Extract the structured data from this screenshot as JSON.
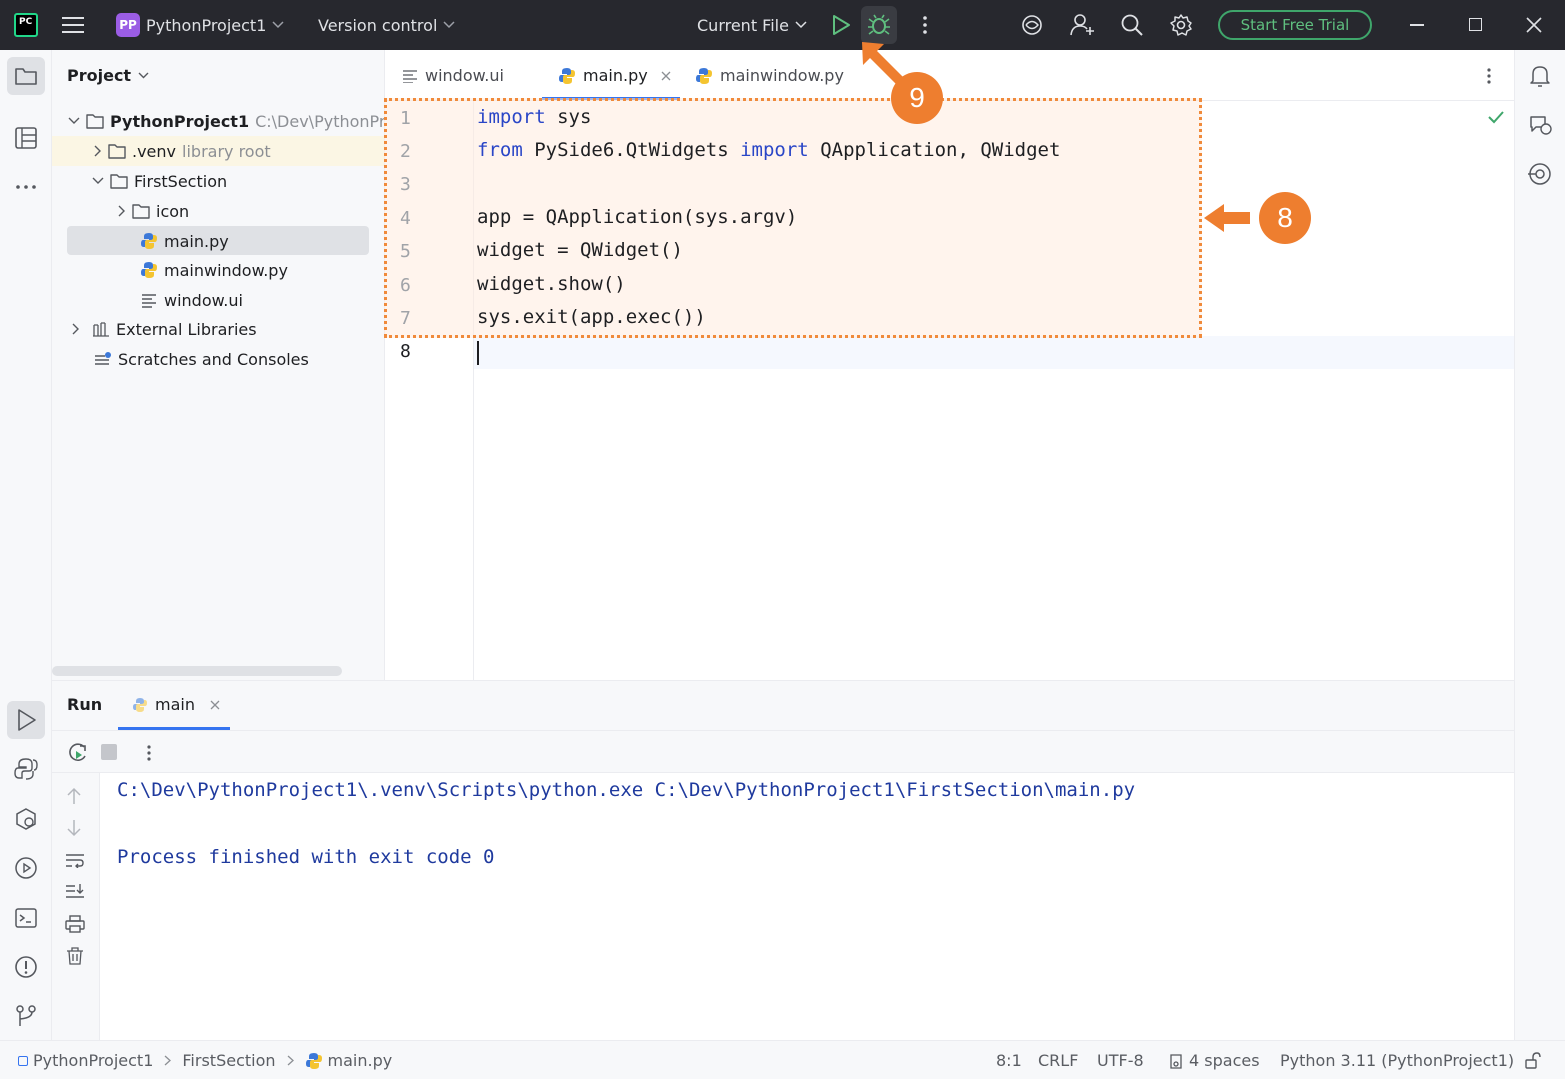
{
  "titlebar": {
    "project_badge": "PP",
    "project_name": "PythonProject1",
    "version_control": "Version control",
    "run_config": "Current File",
    "trial_button": "Start Free Trial"
  },
  "project_panel": {
    "title": "Project",
    "tree": [
      {
        "label": "PythonProject1",
        "hint": "C:\\Dev\\PythonProj"
      },
      {
        "label": ".venv",
        "hint": "library root"
      },
      {
        "label": "FirstSection"
      },
      {
        "label": "icon"
      },
      {
        "label": "main.py"
      },
      {
        "label": "mainwindow.py"
      },
      {
        "label": "window.ui"
      },
      {
        "label": "External Libraries"
      },
      {
        "label": "Scratches and Consoles"
      }
    ]
  },
  "editor": {
    "tabs": [
      {
        "label": "window.ui"
      },
      {
        "label": "main.py",
        "active": true
      },
      {
        "label": "mainwindow.py"
      }
    ],
    "lines": [
      {
        "n": "1",
        "kw1": "import",
        "rest1": " sys",
        "kw2": "",
        "rest2": ""
      },
      {
        "n": "2",
        "kw1": "from",
        "rest1": " PySide6.QtWidgets ",
        "kw2": "import",
        "rest2": " QApplication, QWidget"
      },
      {
        "n": "3",
        "kw1": "",
        "rest1": "",
        "kw2": "",
        "rest2": ""
      },
      {
        "n": "4",
        "kw1": "",
        "rest1": "app = QApplication(sys.argv)",
        "kw2": "",
        "rest2": ""
      },
      {
        "n": "5",
        "kw1": "",
        "rest1": "widget = QWidget()",
        "kw2": "",
        "rest2": ""
      },
      {
        "n": "6",
        "kw1": "",
        "rest1": "widget.show()",
        "kw2": "",
        "rest2": ""
      },
      {
        "n": "7",
        "kw1": "",
        "rest1": "sys.exit(app.exec())",
        "kw2": "",
        "rest2": ""
      },
      {
        "n": "8",
        "kw1": "",
        "rest1": "",
        "kw2": "",
        "rest2": ""
      }
    ]
  },
  "callouts": {
    "code_callout": "8",
    "debug_callout": "9"
  },
  "run_panel": {
    "title": "Run",
    "tab": "main",
    "output": [
      "C:\\Dev\\PythonProject1\\.venv\\Scripts\\python.exe C:\\Dev\\PythonProject1\\FirstSection\\main.py",
      "",
      "Process finished with exit code 0"
    ]
  },
  "statusbar": {
    "breadcrumb": [
      "PythonProject1",
      "FirstSection",
      "main.py"
    ],
    "position": "8:1",
    "line_sep": "CRLF",
    "encoding": "UTF-8",
    "indent": "4 spaces",
    "interpreter": "Python 3.11 (PythonProject1)"
  },
  "colors": {
    "accent_orange": "#ee7e2f",
    "keyword": "#2a46c7",
    "output": "#1f3a9e",
    "run_green": "#3fa66b"
  }
}
